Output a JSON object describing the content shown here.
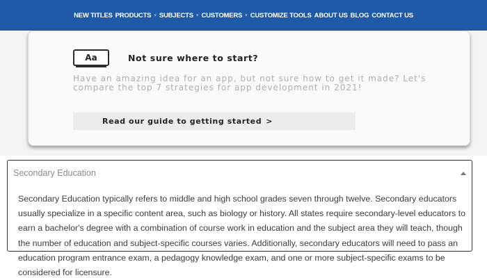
{
  "nav": {
    "items": [
      "NEW TITLES",
      "PRODUCTS",
      "SUBJECTS",
      "CUSTOMERS",
      "CUSTOMIZE TOOLS",
      "ABOUT US",
      "BLOG",
      "CONTACT US"
    ]
  },
  "promo": {
    "icon_label": "Aa",
    "title": "Not sure where to start?",
    "text": "Have an amazing idea for an app, but not sure how to get it made? Let's compare the top 7 strategies for app development in 2021!",
    "button_label": "Read our guide to getting started",
    "button_arrow": ">"
  },
  "accordion": {
    "title": "Secondary Education",
    "body": "Secondary Education typically refers to middle and high school grades seven through twelve. Secondary educators usually specialize in a specific content area, such as biology or history. All states require secondary-level educators to earn a bachelor's degree with a combination of course work in education and the subject area they will teach, though the number of education and subject-specific courses varies. Additionally, secondary educators will need to pass an education program entrance exam, a pedagogy knowledge exam, and one or more subject-specific exams to be considered for licensure."
  },
  "colors": {
    "nav_bg": "#1f5aa8",
    "promo_bg": "#fbfafa",
    "button_bg": "#eeecea"
  }
}
